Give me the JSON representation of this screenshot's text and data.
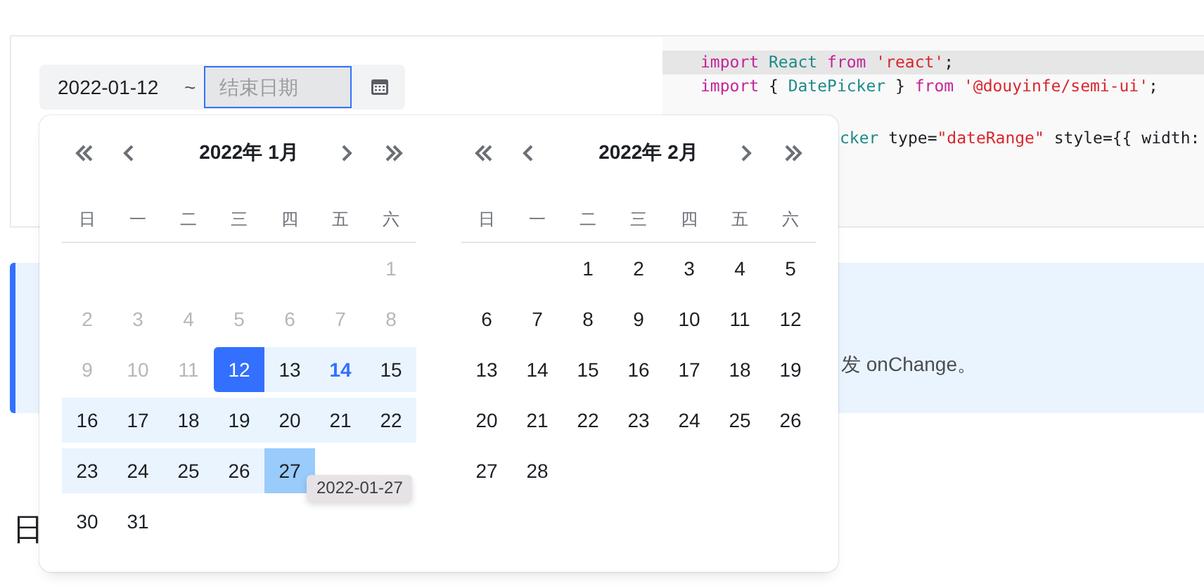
{
  "date_range": {
    "start_value": "2022-01-12",
    "separator": "~",
    "end_placeholder": "结束日期"
  },
  "code": [
    {
      "highlighted": true,
      "tokens": [
        {
          "text": "import",
          "kind": "keyword"
        },
        {
          "text": " React",
          "kind": "name"
        },
        {
          "text": " from",
          "kind": "keyword"
        },
        {
          "text": " 'react'",
          "kind": "string"
        },
        {
          "text": ";",
          "kind": "plain"
        }
      ]
    },
    {
      "highlighted": false,
      "tokens": [
        {
          "text": "import",
          "kind": "keyword"
        },
        {
          "text": " {",
          "kind": "plain"
        },
        {
          "text": " DatePicker",
          "kind": "name"
        },
        {
          "text": " }",
          "kind": "plain"
        },
        {
          "text": " from",
          "kind": "keyword"
        },
        {
          "text": " '@douyinfe/semi-ui'",
          "kind": "string"
        },
        {
          "text": ";",
          "kind": "plain"
        }
      ]
    },
    {
      "highlighted": false,
      "tokens": [
        {
          "text": "cker",
          "kind": "name"
        },
        {
          "text": " type=",
          "kind": "plain"
        },
        {
          "text": "\"dateRange\"",
          "kind": "string"
        },
        {
          "text": " style={{ width:",
          "kind": "plain"
        }
      ]
    }
  ],
  "info": {
    "text": "发 onChange。"
  },
  "heading": "日",
  "calendar": {
    "tooltip": "2022-01-27",
    "months": [
      {
        "title": "2022年 1月",
        "weekdays": [
          "日",
          "一",
          "二",
          "三",
          "四",
          "五",
          "六"
        ],
        "weeks": [
          [
            {
              "kind": "blank"
            },
            {
              "kind": "blank"
            },
            {
              "kind": "blank"
            },
            {
              "kind": "blank"
            },
            {
              "kind": "blank"
            },
            {
              "kind": "blank"
            },
            {
              "label": "1",
              "kind": "disabled"
            }
          ],
          [
            {
              "label": "2",
              "kind": "disabled"
            },
            {
              "label": "3",
              "kind": "disabled"
            },
            {
              "label": "4",
              "kind": "disabled"
            },
            {
              "label": "5",
              "kind": "disabled"
            },
            {
              "label": "6",
              "kind": "disabled"
            },
            {
              "label": "7",
              "kind": "disabled"
            },
            {
              "label": "8",
              "kind": "disabled"
            }
          ],
          [
            {
              "label": "9",
              "kind": "disabled"
            },
            {
              "label": "10",
              "kind": "disabled"
            },
            {
              "label": "11",
              "kind": "disabled"
            },
            {
              "label": "12",
              "kind": "start"
            },
            {
              "label": "13",
              "kind": "range"
            },
            {
              "label": "14",
              "kind": "today"
            },
            {
              "label": "15",
              "kind": "range"
            }
          ],
          [
            {
              "label": "16",
              "kind": "range"
            },
            {
              "label": "17",
              "kind": "range"
            },
            {
              "label": "18",
              "kind": "range"
            },
            {
              "label": "19",
              "kind": "range"
            },
            {
              "label": "20",
              "kind": "range"
            },
            {
              "label": "21",
              "kind": "range"
            },
            {
              "label": "22",
              "kind": "range"
            }
          ],
          [
            {
              "label": "23",
              "kind": "range"
            },
            {
              "label": "24",
              "kind": "range"
            },
            {
              "label": "25",
              "kind": "range"
            },
            {
              "label": "26",
              "kind": "range"
            },
            {
              "label": "27",
              "kind": "hover"
            },
            {
              "kind": "blank"
            },
            {
              "kind": "blank"
            }
          ],
          [
            {
              "label": "30",
              "kind": "day"
            },
            {
              "label": "31",
              "kind": "day"
            },
            {
              "kind": "blank"
            },
            {
              "kind": "blank"
            },
            {
              "kind": "blank"
            },
            {
              "kind": "blank"
            },
            {
              "kind": "blank"
            }
          ]
        ]
      },
      {
        "title": "2022年 2月",
        "weekdays": [
          "日",
          "一",
          "二",
          "三",
          "四",
          "五",
          "六"
        ],
        "weeks": [
          [
            {
              "kind": "blank"
            },
            {
              "kind": "blank"
            },
            {
              "label": "1",
              "kind": "day"
            },
            {
              "label": "2",
              "kind": "day"
            },
            {
              "label": "3",
              "kind": "day"
            },
            {
              "label": "4",
              "kind": "day"
            },
            {
              "label": "5",
              "kind": "day"
            }
          ],
          [
            {
              "label": "6",
              "kind": "day"
            },
            {
              "label": "7",
              "kind": "day"
            },
            {
              "label": "8",
              "kind": "day"
            },
            {
              "label": "9",
              "kind": "day"
            },
            {
              "label": "10",
              "kind": "day"
            },
            {
              "label": "11",
              "kind": "day"
            },
            {
              "label": "12",
              "kind": "day"
            }
          ],
          [
            {
              "label": "13",
              "kind": "day"
            },
            {
              "label": "14",
              "kind": "day"
            },
            {
              "label": "15",
              "kind": "day"
            },
            {
              "label": "16",
              "kind": "day"
            },
            {
              "label": "17",
              "kind": "day"
            },
            {
              "label": "18",
              "kind": "day"
            },
            {
              "label": "19",
              "kind": "day"
            }
          ],
          [
            {
              "label": "20",
              "kind": "day"
            },
            {
              "label": "21",
              "kind": "day"
            },
            {
              "label": "22",
              "kind": "day"
            },
            {
              "label": "23",
              "kind": "day"
            },
            {
              "label": "24",
              "kind": "day"
            },
            {
              "label": "25",
              "kind": "day"
            },
            {
              "label": "26",
              "kind": "day"
            }
          ],
          [
            {
              "label": "27",
              "kind": "day"
            },
            {
              "label": "28",
              "kind": "day"
            },
            {
              "kind": "blank"
            },
            {
              "kind": "blank"
            },
            {
              "kind": "blank"
            },
            {
              "kind": "blank"
            },
            {
              "kind": "blank"
            }
          ]
        ]
      }
    ]
  }
}
